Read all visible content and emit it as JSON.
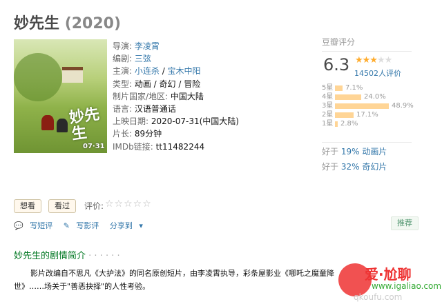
{
  "title": {
    "name": "妙先生",
    "year": "(2020)"
  },
  "poster": {
    "title_text": "妙先生",
    "date_text": "07·31"
  },
  "info": {
    "director_label": "导演: ",
    "director": "李凌霄",
    "writer_label": "编剧: ",
    "writer": "三弦",
    "cast_label": "主演: ",
    "cast1": "小连杀",
    "cast_sep": " / ",
    "cast2": "宝木中阳",
    "genre_label": "类型: ",
    "genre": "动画 / 奇幻 / 冒险",
    "country_label": "制片国家/地区: ",
    "country": "中国大陆",
    "language_label": "语言: ",
    "language": "汉语普通话",
    "release_label": "上映日期: ",
    "release": "2020-07-31(中国大陆)",
    "runtime_label": "片长: ",
    "runtime": "89分钟",
    "imdb_label": "IMDb链接: ",
    "imdb": "tt11482244"
  },
  "rating": {
    "header": "豆瓣评分",
    "score": "6.3",
    "stars_on": "★★★",
    "stars_off": "★★",
    "count": "14502人评价",
    "distribution": [
      {
        "label": "5星",
        "pct_text": "7.1%",
        "pct": 7.1
      },
      {
        "label": "4星",
        "pct_text": "24.0%",
        "pct": 24.0
      },
      {
        "label": "3星",
        "pct_text": "48.9%",
        "pct": 48.9
      },
      {
        "label": "2星",
        "pct_text": "17.1%",
        "pct": 17.1
      },
      {
        "label": "1星",
        "pct_text": "2.8%",
        "pct": 2.8
      }
    ],
    "better1_prefix": "好于 ",
    "better1_pct": "19%",
    "better1_cat": "动画片",
    "better2_prefix": "好于 ",
    "better2_pct": "32%",
    "better2_cat": "奇幻片"
  },
  "actions": {
    "want": "想看",
    "seen": "看过",
    "rate_label": "评价:",
    "rate_stars": "☆☆☆☆☆"
  },
  "links": {
    "short_review": "写短评",
    "review": "写影评",
    "share": "分享到",
    "recommend": "推荐"
  },
  "synopsis": {
    "title": "妙先生的剧情简介",
    "dots": " · · · · · ·",
    "text": "影片改编自不思凡《大护法》的同名原创短片，由李凌霄执导，彩条屋影业《哪吒之魔童降世》……场关于\"善恶抉择\"的人性考验。"
  },
  "watermark": {
    "name": "爱·尬聊",
    "url": "www.igaliao.com",
    "url2": "qkoufu.com"
  }
}
